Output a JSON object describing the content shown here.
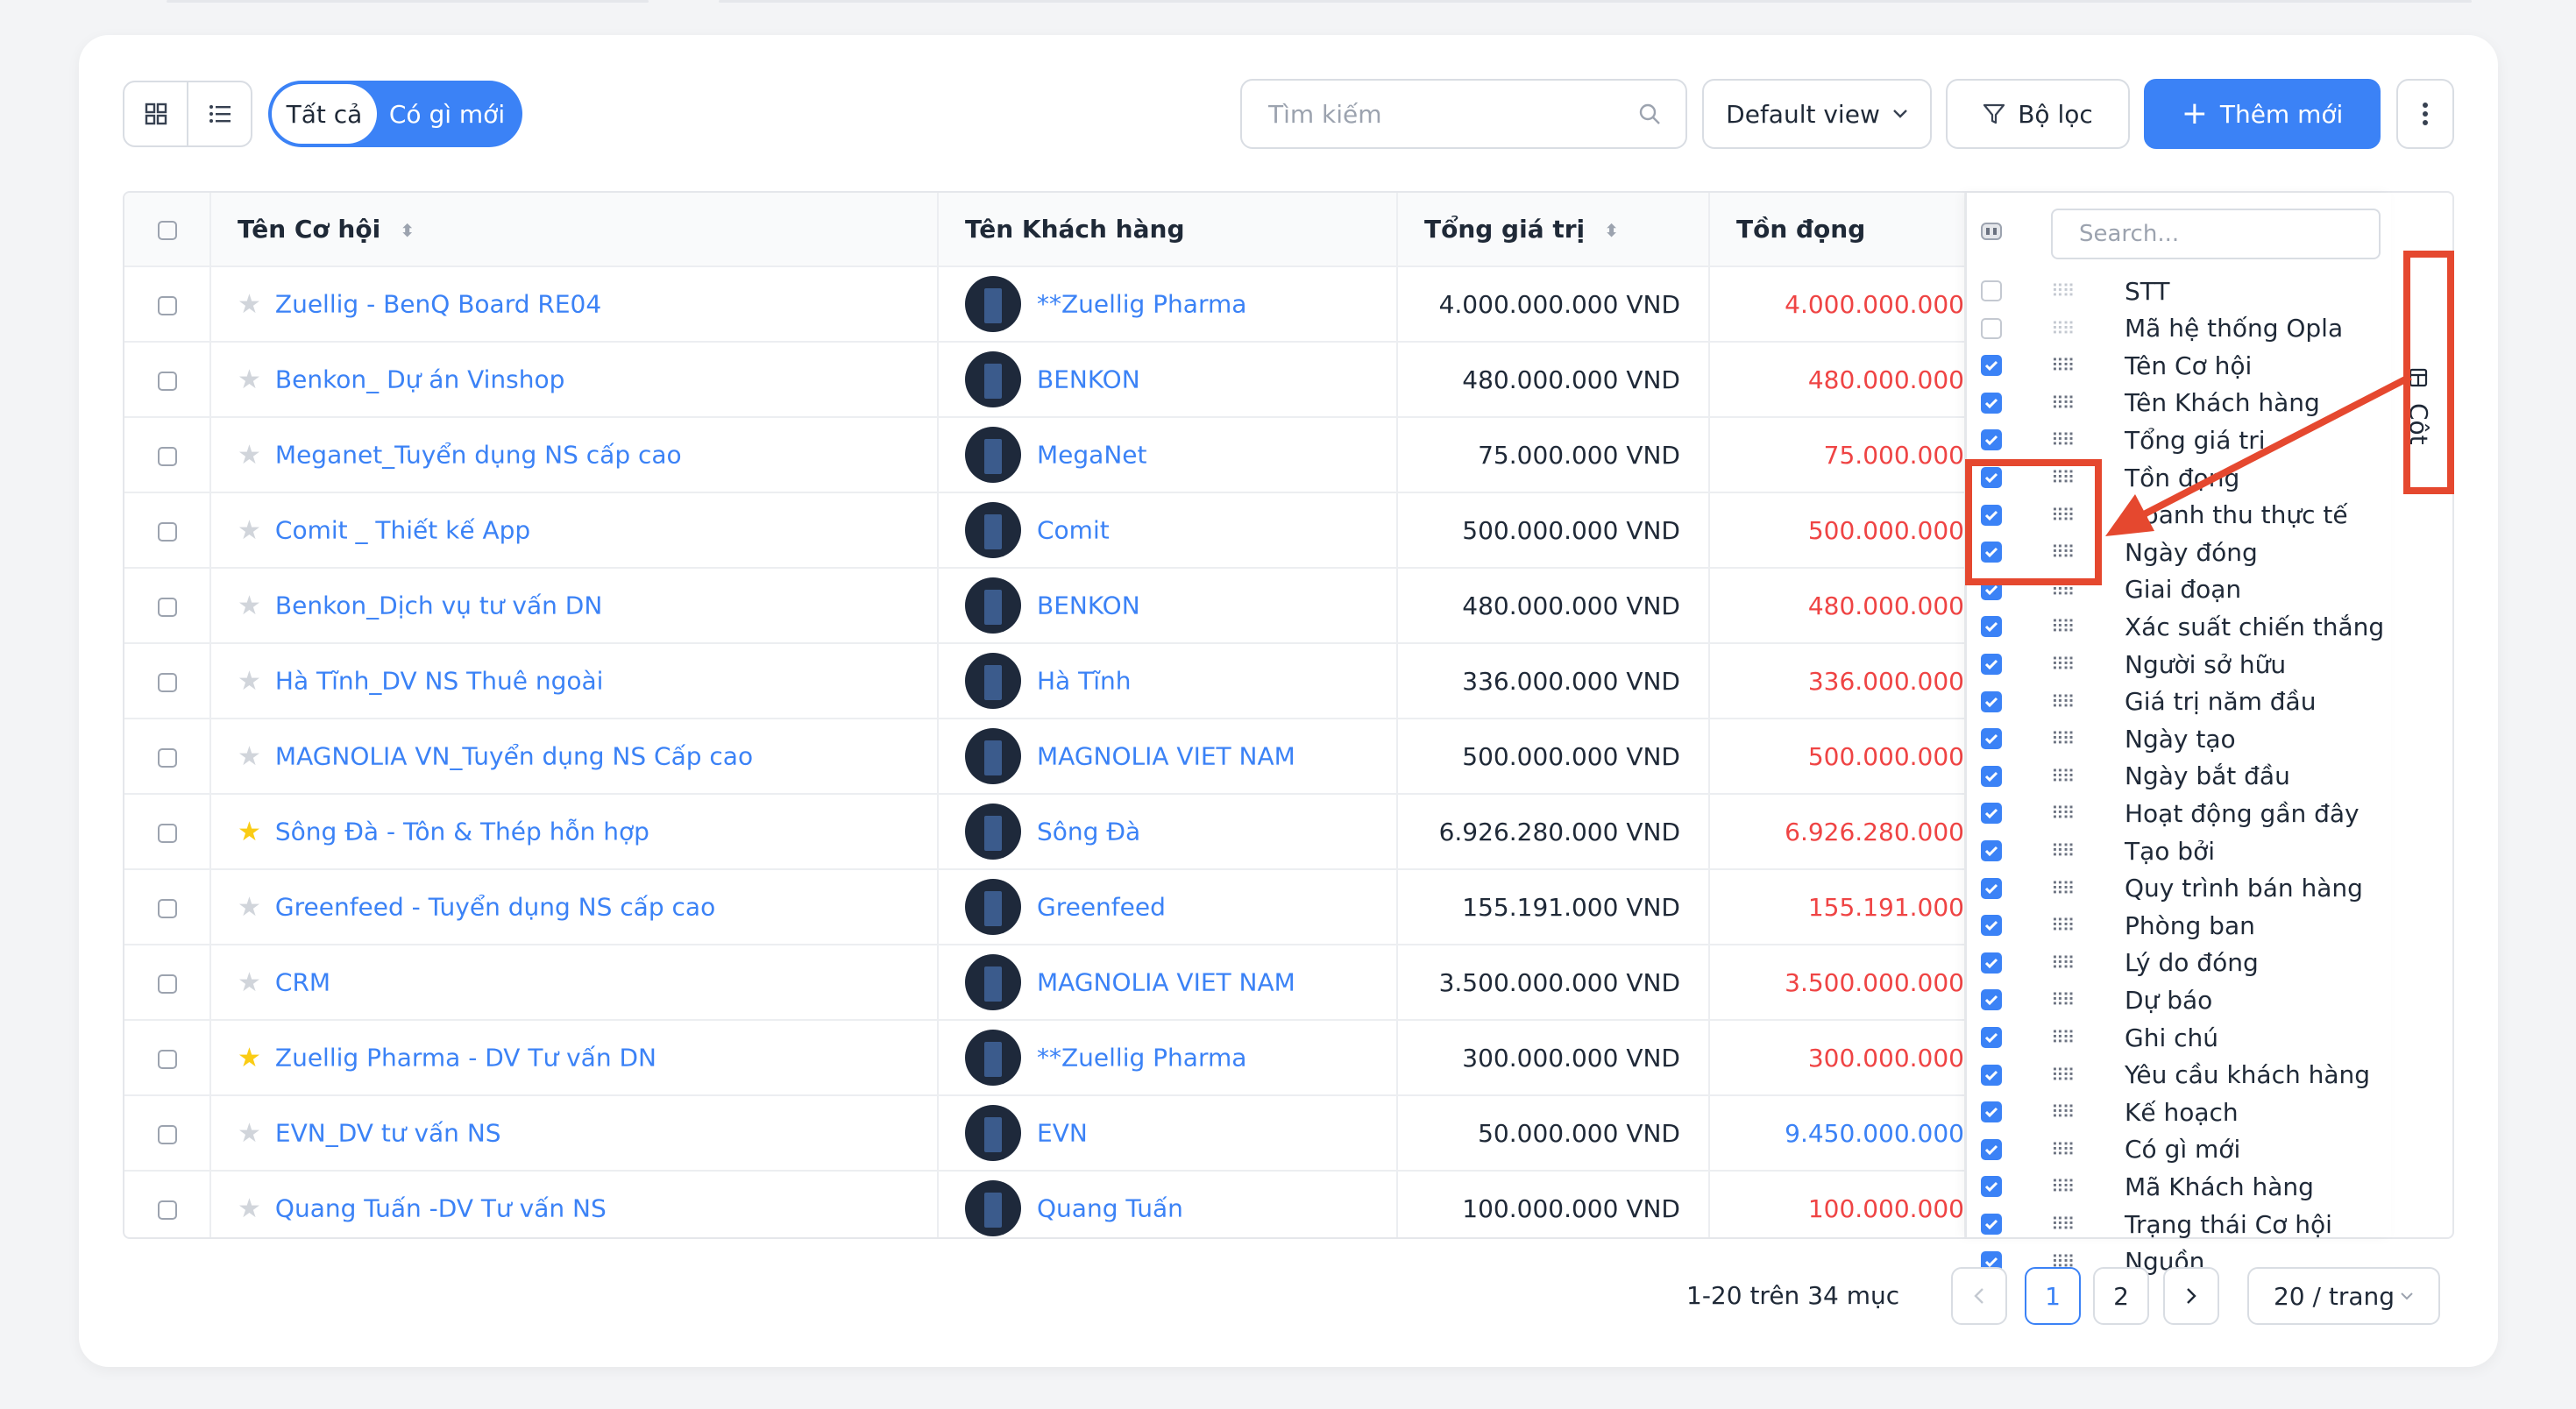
{
  "toolbar": {
    "view_grid_icon": "grid-icon",
    "view_list_icon": "list-icon",
    "filter_all": "Tất cả",
    "filter_new": "Có gì mới",
    "search_placeholder": "Tìm kiếm",
    "default_view": "Default view",
    "filter_button": "Bộ lọc",
    "add_button": "Thêm mới"
  },
  "table": {
    "columns": [
      "Tên Cơ hội",
      "Tên Khách hàng",
      "Tổng giá trị",
      "Tồn đọng"
    ],
    "rows": [
      {
        "name": "Zuellig - BenQ Board RE04",
        "starred": false,
        "customer": "**Zuellig Pharma",
        "total": "4.000.000.000 VND",
        "backlog": "4.000.000.000",
        "backlog_color": "red"
      },
      {
        "name": "Benkon_ Dự án Vinshop",
        "starred": false,
        "customer": "BENKON",
        "total": "480.000.000 VND",
        "backlog": "480.000.000",
        "backlog_color": "red"
      },
      {
        "name": "Meganet_Tuyển dụng NS cấp cao",
        "starred": false,
        "customer": "MegaNet",
        "total": "75.000.000 VND",
        "backlog": "75.000.000",
        "backlog_color": "red"
      },
      {
        "name": "Comit _ Thiết kế App",
        "starred": false,
        "customer": "Comit",
        "total": "500.000.000 VND",
        "backlog": "500.000.000",
        "backlog_color": "red"
      },
      {
        "name": "Benkon_Dịch vụ tư vấn DN",
        "starred": false,
        "customer": "BENKON",
        "total": "480.000.000 VND",
        "backlog": "480.000.000",
        "backlog_color": "red"
      },
      {
        "name": "Hà Tĩnh_DV NS Thuê ngoài",
        "starred": false,
        "customer": "Hà Tĩnh",
        "total": "336.000.000 VND",
        "backlog": "336.000.000",
        "backlog_color": "red"
      },
      {
        "name": "MAGNOLIA VN_Tuyển dụng NS Cấp cao",
        "starred": false,
        "customer": "MAGNOLIA VIET NAM",
        "total": "500.000.000 VND",
        "backlog": "500.000.000",
        "backlog_color": "red"
      },
      {
        "name": "Sông Đà - Tôn & Thép hỗn hợp",
        "starred": true,
        "customer": "Sông Đà",
        "total": "6.926.280.000 VND",
        "backlog": "6.926.280.000",
        "backlog_color": "red"
      },
      {
        "name": "Greenfeed - Tuyển dụng NS cấp cao",
        "starred": false,
        "customer": "Greenfeed",
        "total": "155.191.000 VND",
        "backlog": "155.191.000",
        "backlog_color": "red"
      },
      {
        "name": "CRM",
        "starred": false,
        "customer": "MAGNOLIA VIET NAM",
        "total": "3.500.000.000 VND",
        "backlog": "3.500.000.000",
        "backlog_color": "red"
      },
      {
        "name": "Zuellig Pharma - DV Tư vấn DN",
        "starred": true,
        "customer": "**Zuellig Pharma",
        "total": "300.000.000 VND",
        "backlog": "300.000.000",
        "backlog_color": "red"
      },
      {
        "name": "EVN_DV tư vấn NS",
        "starred": false,
        "customer": "EVN",
        "total": "50.000.000 VND",
        "backlog": "9.450.000.000",
        "backlog_color": "blue"
      },
      {
        "name": "Quang Tuấn -DV Tư vấn NS",
        "starred": false,
        "customer": "Quang Tuấn",
        "total": "100.000.000 VND",
        "backlog": "100.000.000",
        "backlog_color": "red"
      }
    ]
  },
  "column_panel": {
    "search_placeholder": "Search...",
    "tab_label": "Cột",
    "items": [
      {
        "label": "STT",
        "checked": false
      },
      {
        "label": "Mã hệ thống Opla",
        "checked": false
      },
      {
        "label": "Tên Cơ hội",
        "checked": true
      },
      {
        "label": "Tên Khách hàng",
        "checked": true
      },
      {
        "label": "Tổng giá trị",
        "checked": true
      },
      {
        "label": "Tồn đọng",
        "checked": true
      },
      {
        "label": "Doanh thu thực tế",
        "checked": true
      },
      {
        "label": "Ngày đóng",
        "checked": true
      },
      {
        "label": "Giai đoạn",
        "checked": true
      },
      {
        "label": "Xác suất chiến thắng",
        "checked": true
      },
      {
        "label": "Người sở hữu",
        "checked": true
      },
      {
        "label": "Giá trị năm đầu",
        "checked": true
      },
      {
        "label": "Ngày tạo",
        "checked": true
      },
      {
        "label": "Ngày bắt đầu",
        "checked": true
      },
      {
        "label": "Hoạt động gần đây",
        "checked": true
      },
      {
        "label": "Tạo bởi",
        "checked": true
      },
      {
        "label": "Quy trình bán hàng",
        "checked": true
      },
      {
        "label": "Phòng ban",
        "checked": true
      },
      {
        "label": "Lý do đóng",
        "checked": true
      },
      {
        "label": "Dự báo",
        "checked": true
      },
      {
        "label": "Ghi chú",
        "checked": true
      },
      {
        "label": "Yêu cầu khách hàng",
        "checked": true
      },
      {
        "label": "Kế hoạch",
        "checked": true
      },
      {
        "label": "Có gì mới",
        "checked": true
      },
      {
        "label": "Mã Khách hàng",
        "checked": true
      },
      {
        "label": "Trạng thái Cơ hội",
        "checked": true
      },
      {
        "label": "Nguồn",
        "checked": true
      }
    ]
  },
  "pagination": {
    "summary": "1-20 trên 34 mục",
    "pages": [
      "1",
      "2"
    ],
    "current": "1",
    "page_size": "20 / trang"
  },
  "colors": {
    "accent": "#3b82f6",
    "danger": "#ef4444",
    "annotation": "#e5482f"
  }
}
